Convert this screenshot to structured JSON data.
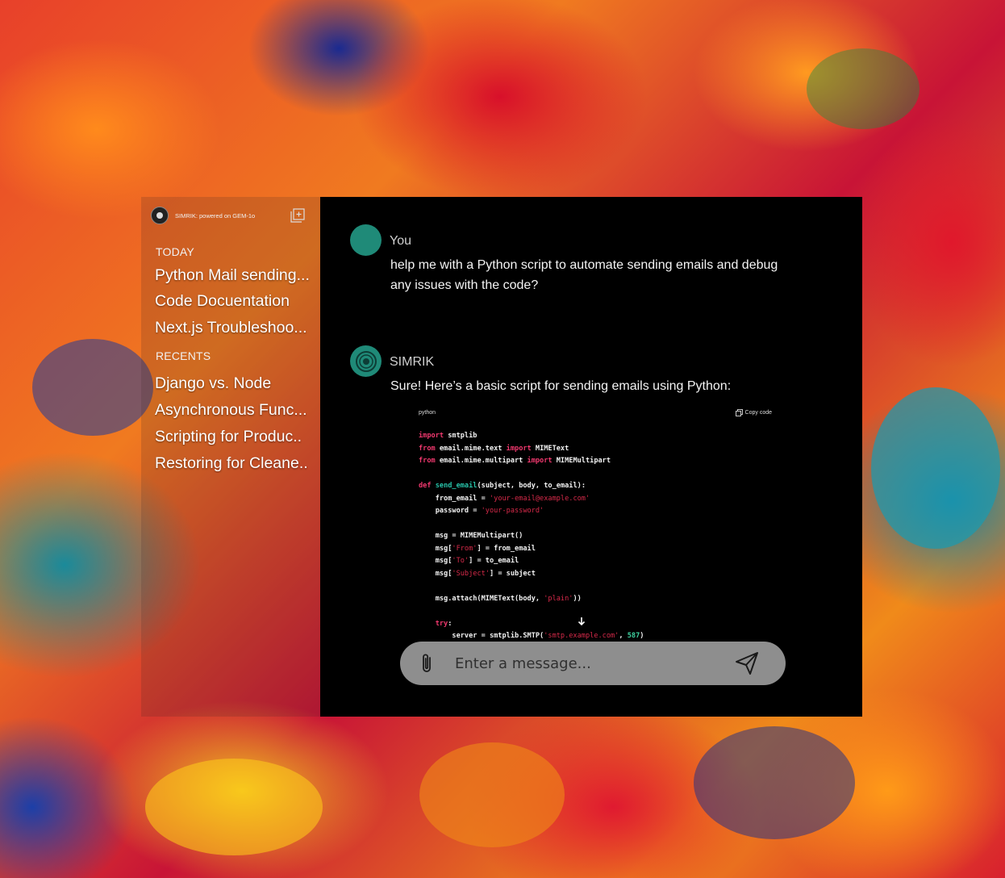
{
  "sidebar": {
    "brand": "SIMRIK: powered on GEM-1o",
    "sections": [
      {
        "label": "TODAY",
        "items": [
          "Python Mail sending...",
          "Code Docuentation",
          "Next.js Troubleshoo..."
        ]
      },
      {
        "label": "RECENTS",
        "items": [
          "Django vs. Node",
          "Asynchronous Func...",
          "Scripting for Produc..",
          "Restoring for Cleane.."
        ]
      }
    ]
  },
  "chat": {
    "user": {
      "name": "You",
      "message": "help me with a Python script to automate sending emails and debug any issues with the code?"
    },
    "assistant": {
      "name": "SIMRIK",
      "message": "Sure! Here’s a basic script for sending emails using Python:",
      "code": {
        "language": "python",
        "copy_label": "Copy code"
      }
    }
  },
  "input": {
    "placeholder": "Enter a message..."
  },
  "icons": {
    "logo": "simrik-logo-icon",
    "new_chat": "new-chat-icon",
    "copy": "copy-icon",
    "scroll": "arrow-down-icon",
    "attach": "paperclip-icon",
    "send": "send-icon"
  },
  "colors": {
    "avatar": "#1f8a78",
    "chat_bg": "#000000",
    "input_bg": "#8e8e8e",
    "keyword": "#f0386e",
    "function": "#27c2a8",
    "string": "#d82a4a"
  }
}
